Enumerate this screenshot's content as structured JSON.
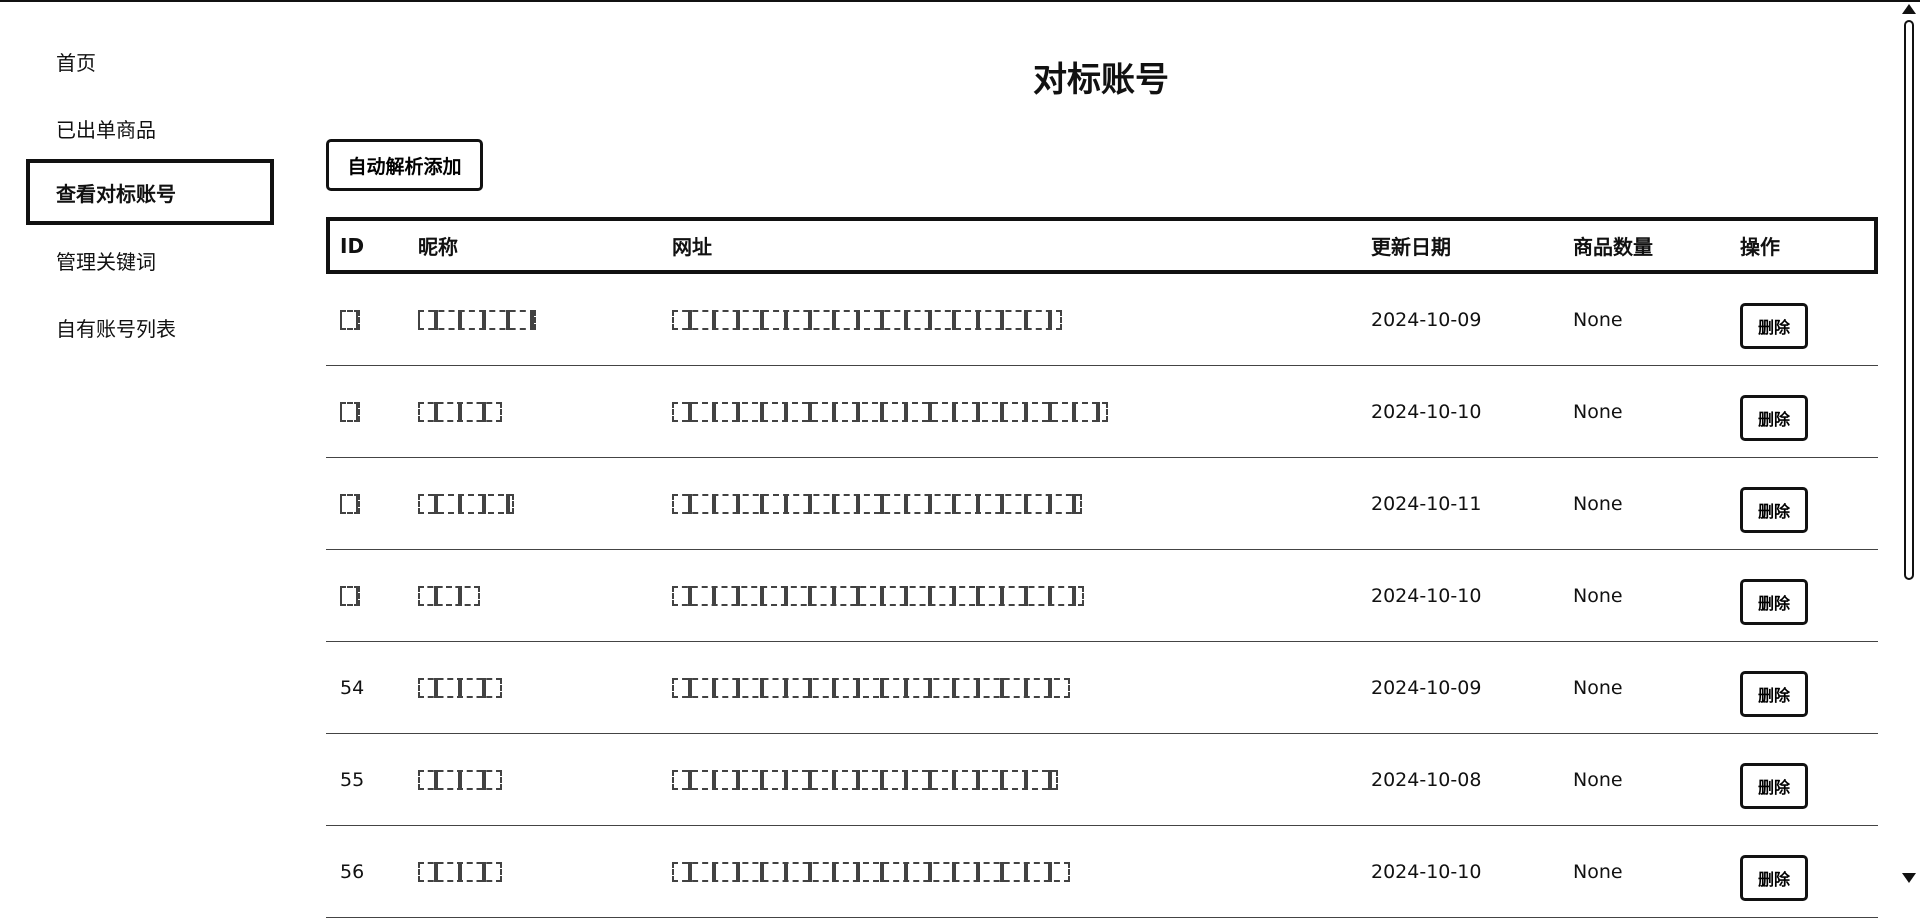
{
  "sidebar": {
    "items": [
      {
        "label": "首页",
        "active": false
      },
      {
        "label": "已出单商品",
        "active": false
      },
      {
        "label": "查看对标账号",
        "active": true
      },
      {
        "label": "管理关键词",
        "active": false
      },
      {
        "label": "自有账号列表",
        "active": false
      }
    ]
  },
  "main": {
    "title": "对标账号",
    "auto_add_button": "自动解析添加",
    "table": {
      "headers": [
        "ID",
        "昵称",
        "网址",
        "更新日期",
        "商品数量",
        "操作"
      ],
      "rows": [
        {
          "id": "",
          "date": "2024-10-09",
          "count": "None",
          "action": "删除",
          "nick_w": 118,
          "url_w": 390
        },
        {
          "id": "",
          "date": "2024-10-10",
          "count": "None",
          "action": "删除",
          "nick_w": 84,
          "url_w": 436
        },
        {
          "id": "",
          "date": "2024-10-11",
          "count": "None",
          "action": "删除",
          "nick_w": 96,
          "url_w": 410
        },
        {
          "id": "",
          "date": "2024-10-10",
          "count": "None",
          "action": "删除",
          "nick_w": 62,
          "url_w": 412
        },
        {
          "id": "54",
          "date": "2024-10-09",
          "count": "None",
          "action": "删除",
          "nick_w": 84,
          "url_w": 398
        },
        {
          "id": "55",
          "date": "2024-10-08",
          "count": "None",
          "action": "删除",
          "nick_w": 84,
          "url_w": 386
        },
        {
          "id": "56",
          "date": "2024-10-10",
          "count": "None",
          "action": "删除",
          "nick_w": 84,
          "url_w": 398
        }
      ]
    }
  }
}
